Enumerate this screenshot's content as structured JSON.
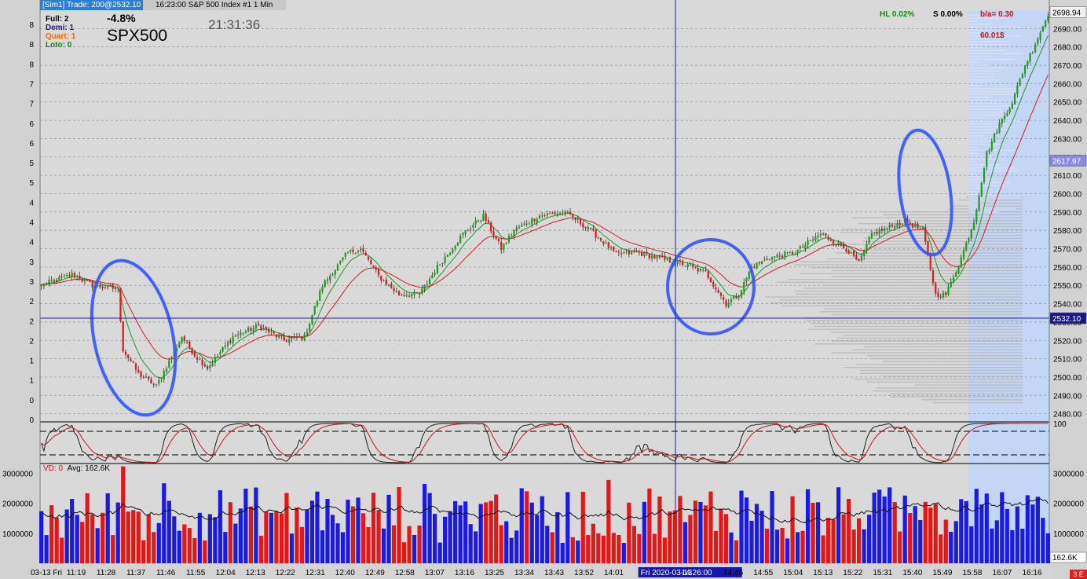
{
  "header": {
    "account_tag": "[Sim1] Trade: 200@2532.10",
    "title": "16:23:00 S&P 500 Index #1 1 Min"
  },
  "lots": [
    {
      "label": "Full: 2",
      "color": "#000000"
    },
    {
      "label": "Demi: 1",
      "color": "#1a1aa0"
    },
    {
      "label": "Quart: 1",
      "color": "#e07000"
    },
    {
      "label": "Loto: 0",
      "color": "#1a8a1a"
    }
  ],
  "overlay": {
    "change_pct": "-4.8%",
    "symbol": "SPX500",
    "clock": "21:31:36",
    "hl": "HL 0.02%",
    "s_pct": "S 0.00%",
    "ba": "b/a= 0.30",
    "dollars": "60.01$"
  },
  "volume_panel": {
    "vd_label": "VD: 0",
    "avg_label": "Avg: 162.6K",
    "badge": "162.6K"
  },
  "corner_badge": "3 E",
  "colors": {
    "background": "#d9d9d9",
    "up": "#1fa01f",
    "down": "#d82020",
    "vol_up": "#1a1ae0",
    "vol_down": "#e01818",
    "ma_fast": "#1f9a1f",
    "ma_slow": "#d81e1e",
    "highlight": "#2f55ff",
    "session_shade": "#c4d6f6",
    "profile": "#b4b4b4"
  },
  "chart_data": {
    "type": "candlestick",
    "y_ticks": [
      2480,
      2490,
      2500,
      2510,
      2520,
      2530,
      2540,
      2550,
      2560,
      2570,
      2580,
      2590,
      2600,
      2610,
      2620,
      2630,
      2640,
      2650,
      2660,
      2670,
      2680,
      2690
    ],
    "ylim": [
      2476,
      2700
    ],
    "left_axis_labels": [
      "8",
      "8",
      "8",
      "7",
      "7",
      "6",
      "6",
      "5",
      "5",
      "4",
      "4",
      "4",
      "3",
      "3",
      "2",
      "2",
      "2",
      "1",
      "1",
      "0",
      "0"
    ],
    "x_tick_labels": [
      "03-13 Fri",
      "11:19",
      "11:28",
      "11:37",
      "11:46",
      "11:55",
      "12:04",
      "12:13",
      "12:22",
      "12:31",
      "12:40",
      "12:49",
      "12:58",
      "13:07",
      "13:16",
      "13:25",
      "13:34",
      "13:43",
      "13:52",
      "14:01",
      "14",
      "Fri 2020-03-13",
      "14:26:00",
      "14:46",
      "14:55",
      "15:04",
      "15:13",
      "15:22",
      "15:31",
      "15:40",
      "15:49",
      "15:58",
      "16:07",
      "16:16"
    ],
    "price_markers": [
      {
        "value": 2698.94,
        "label": "2698.94",
        "style": "last"
      },
      {
        "value": 2617.97,
        "label": "2617.97",
        "style": "level"
      },
      {
        "value": 2532.1,
        "label": "2532.10",
        "style": "cursor"
      }
    ],
    "anchors": [
      [
        0,
        2550
      ],
      [
        12,
        2556
      ],
      [
        20,
        2550
      ],
      [
        30,
        2548
      ],
      [
        32,
        2515
      ],
      [
        38,
        2502
      ],
      [
        45,
        2495
      ],
      [
        55,
        2522
      ],
      [
        60,
        2512
      ],
      [
        65,
        2505
      ],
      [
        75,
        2522
      ],
      [
        85,
        2528
      ],
      [
        95,
        2520
      ],
      [
        103,
        2522
      ],
      [
        110,
        2550
      ],
      [
        120,
        2568
      ],
      [
        125,
        2570
      ],
      [
        132,
        2555
      ],
      [
        140,
        2545
      ],
      [
        148,
        2545
      ],
      [
        155,
        2560
      ],
      [
        165,
        2578
      ],
      [
        173,
        2588
      ],
      [
        180,
        2570
      ],
      [
        185,
        2580
      ],
      [
        195,
        2588
      ],
      [
        205,
        2590
      ],
      [
        215,
        2580
      ],
      [
        225,
        2567
      ],
      [
        233,
        2568
      ],
      [
        241,
        2565
      ],
      [
        250,
        2562
      ],
      [
        260,
        2557
      ],
      [
        268,
        2540
      ],
      [
        273,
        2545
      ],
      [
        278,
        2560
      ],
      [
        285,
        2565
      ],
      [
        295,
        2568
      ],
      [
        305,
        2578
      ],
      [
        315,
        2570
      ],
      [
        320,
        2562
      ],
      [
        325,
        2578
      ],
      [
        338,
        2585
      ],
      [
        345,
        2580
      ],
      [
        350,
        2545
      ],
      [
        354,
        2545
      ],
      [
        360,
        2565
      ],
      [
        365,
        2585
      ],
      [
        370,
        2622
      ],
      [
        375,
        2638
      ],
      [
        380,
        2650
      ],
      [
        385,
        2670
      ],
      [
        390,
        2685
      ],
      [
        394,
        2698
      ]
    ],
    "candles_total": 395,
    "moving_averages": [
      {
        "period": 8,
        "color": "#1f9a1f"
      },
      {
        "period": 21,
        "color": "#d81e1e"
      }
    ],
    "volume_ticks": [
      1000000,
      2000000,
      3000000
    ],
    "volume_ylim": [
      0,
      3300000
    ],
    "oscillator_bands": [
      80,
      20
    ],
    "oscillator_top_label": "100"
  }
}
